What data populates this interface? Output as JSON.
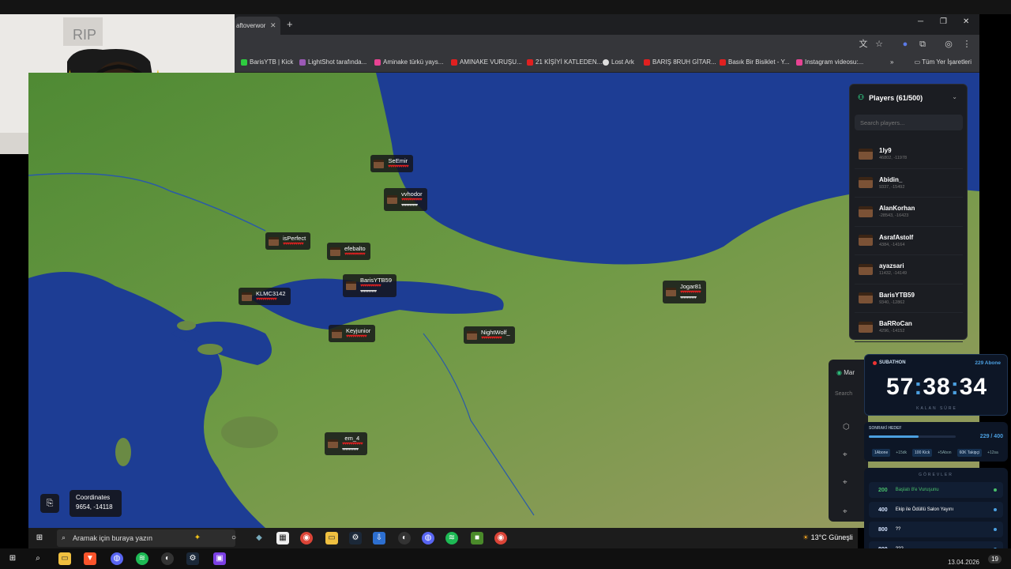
{
  "browser": {
    "tab_title": "aftoverwor",
    "bookmarks": [
      "BarisYTB | Kick",
      "LightShot tarafında...",
      "Aminake türkü yays...",
      "AMINAKE VURUŞU...",
      "21 KİŞİYİ KATLEDEN...",
      "Lost Ark",
      "BARIŞ 8RUH GİTAR...",
      "Basık Bir Bisiklet - Y...",
      "Instagram videosu:..."
    ],
    "bookmarks_all": "Tüm Yer İşaretleri",
    "bookmark_colors": [
      "#2ecc40",
      "#9b59b6",
      "#e84393",
      "#e02020",
      "#e02020",
      "#dddddd",
      "#e02020",
      "#e02020",
      "#e84393"
    ]
  },
  "players_panel": {
    "title": "Players (61/500)",
    "search_placeholder": "Search players...",
    "players": [
      {
        "name": "1ly9",
        "coords": "46802, -11978"
      },
      {
        "name": "Abidin_",
        "coords": "9337, -15492"
      },
      {
        "name": "AlanKorhan",
        "coords": "-28543, -16423"
      },
      {
        "name": "AsrafAstolf",
        "coords": "4384, -14164"
      },
      {
        "name": "ayazsari",
        "coords": "11432, -14149"
      },
      {
        "name": "BarisYTB59",
        "coords": "9340, -12862"
      },
      {
        "name": "BaRRoCan",
        "coords": "4296, -14152"
      }
    ]
  },
  "markers_panel": {
    "title": "Mar",
    "search": "Search"
  },
  "map_markers": [
    {
      "name": "SeEmir",
      "hearts": "♥♥♥♥♥♥♥♥♥♥",
      "food": ""
    },
    {
      "name": "vvhodor",
      "hearts": "♥♥♥♥♥♥♥♥♥♥",
      "food": "▾▾▾▾▾▾▾▾▾▾"
    },
    {
      "name": "isPerfect",
      "hearts": "♥♥♥♥♥♥♥♥♥♥",
      "food": ""
    },
    {
      "name": "efebalto",
      "hearts": "♥♥♥♥♥♥♥♥♥♥",
      "food": ""
    },
    {
      "name": "BarisYTB59",
      "hearts": "♥♥♥♥♥♥♥♥♥♥",
      "food": "▾▾▾▾▾▾▾▾▾▾"
    },
    {
      "name": "KLMC3142",
      "hearts": "♥♥♥♥♥♥♥♥♥♥",
      "food": ""
    },
    {
      "name": "Keyjunior",
      "hearts": "♥♥♥♥♥♥♥♥♥♥",
      "food": ""
    },
    {
      "name": "NightWolf_",
      "hearts": "♥♥♥♥♥♥♥♥♥♥",
      "food": ""
    },
    {
      "name": "Jogar81",
      "hearts": "♥♥♥♥♥♥♥♥♥♥",
      "food": "▾▾▾▾▾▾▾▾▾▾"
    },
    {
      "name": "em_4",
      "hearts": "♥♥♥♥♥♥♥♥♥♥",
      "food": "▾▾▾▾▾▾▾▾▾▾"
    }
  ],
  "coordinates": {
    "title": "Coordinates",
    "value": "9654, -14118"
  },
  "subathon": {
    "tag": "SUBATHON",
    "count": "229 Abone",
    "hours": "57",
    "minutes": "38",
    "seconds": "34",
    "label": "KALAN SÜRE",
    "goal_label": "SONRAKİ HEDEF",
    "goal_value": "229 / 400",
    "goal_progress": 0.57,
    "chips": [
      "1Abone",
      "+15dk",
      "100 Kick",
      "+5Abon",
      "60K Takipçi",
      "+12sa"
    ],
    "tasks_title": "GÖREVLER",
    "tasks": [
      {
        "num": "200",
        "text": "Başlatı 8'e Vuruşunu",
        "done": true
      },
      {
        "num": "400",
        "text": "Ekip ile Ödüllü Salon Yayını",
        "done": false
      },
      {
        "num": "800",
        "text": "??",
        "done": false
      },
      {
        "num": "800",
        "text": "???",
        "done": false
      }
    ]
  },
  "inner_taskbar": {
    "search": "Aramak için buraya yazın",
    "weather": "13°C  Güneşli"
  },
  "outer_taskbar": {
    "date": "13.04.2026",
    "badge": "19"
  },
  "colors": {
    "ocean": "#1c3f8f",
    "land": "#5b8a3a",
    "panel": "#1b1d22",
    "subathon_accent": "#4b9fe0"
  }
}
